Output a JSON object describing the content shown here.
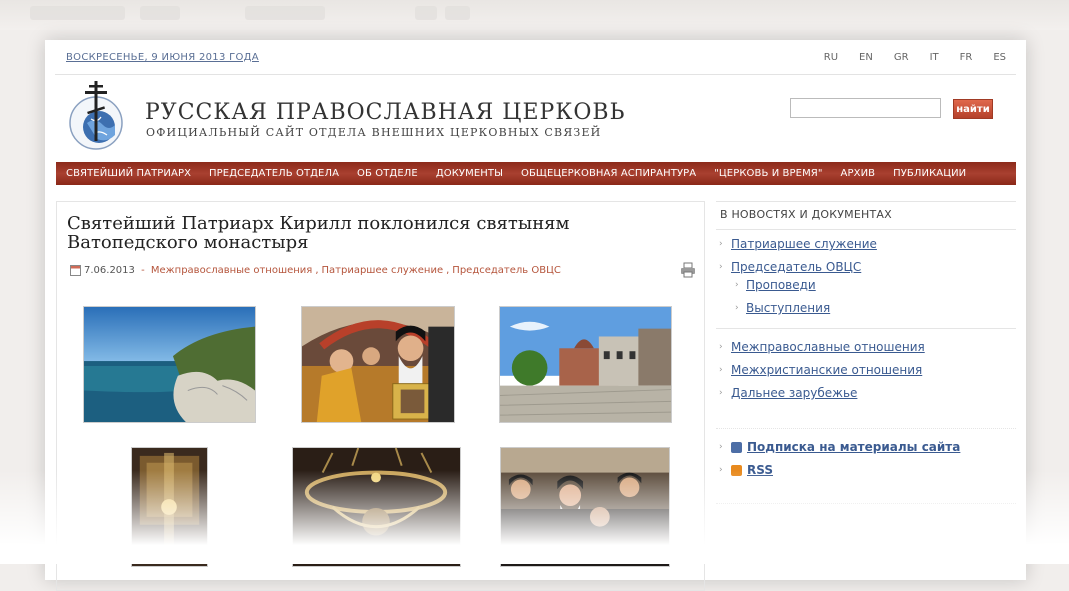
{
  "header": {
    "date": "ВОСКРЕСЕНЬЕ, 9 ИЮНЯ 2013 ГОДА",
    "languages": [
      "RU",
      "EN",
      "GR",
      "IT",
      "FR",
      "ES"
    ],
    "site_title": "РУССКАЯ ПРАВОСЛАВНАЯ ЦЕРКОВЬ",
    "site_subtitle": "ОФИЦИАЛЬНЫЙ САЙТ ОТДЕЛА ВНЕШНИХ ЦЕРКОВНЫХ СВЯЗЕЙ",
    "search_value": "",
    "search_button": "найти"
  },
  "nav": [
    "СВЯТЕЙШИЙ ПАТРИАРХ",
    "ПРЕДСЕДАТЕЛЬ ОТДЕЛА",
    "ОБ ОТДЕЛЕ",
    "ДОКУМЕНТЫ",
    "ОБЩЕЦЕРКОВНАЯ АСПИРАНТУРА",
    "\"ЦЕРКОВЬ И ВРЕМЯ\"",
    "АРХИВ",
    "ПУБЛИКАЦИИ"
  ],
  "article": {
    "title": "Святейший Патриарх Кирилл поклонился святыням Ватопедского монастыря",
    "date": "7.06.2013",
    "separator": " - ",
    "tags": [
      "Межправославные отношения",
      "Патриаршее служение",
      "Председатель ОВЦС"
    ]
  },
  "sidebar": {
    "heading": "В НОВОСТЯХ И ДОКУМЕНТАХ",
    "links": [
      "Патриаршее служение",
      "Председатель ОВЦС"
    ],
    "sublinks": [
      "Проповеди",
      "Выступления"
    ],
    "links2": [
      "Межправославные отношения",
      "Межхристианские отношения",
      "Дальнее зарубежье"
    ],
    "subscribe": "Подписка на материалы сайта",
    "rss": "RSS"
  },
  "colors": {
    "nav_bg": "#9a3322",
    "accent_tag": "#b5553c",
    "link": "#3a5a90",
    "search_button": "#c84e35"
  }
}
